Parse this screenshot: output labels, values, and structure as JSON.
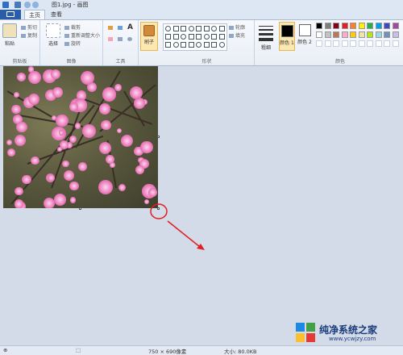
{
  "window": {
    "title": "图1.jpg - 画图"
  },
  "tabs": [
    {
      "label": "主页"
    },
    {
      "label": "查看"
    }
  ],
  "clipboard": {
    "paste_label": "粘贴",
    "cut_label": "剪切",
    "copy_label": "复制",
    "group_label": "剪贴板"
  },
  "image": {
    "select_label": "选择",
    "crop_label": "裁剪",
    "resize_label": "重新调整大小",
    "rotate_label": "旋转",
    "group_label": "图像"
  },
  "tools": {
    "group_label": "工具",
    "text_tool": "A"
  },
  "brushes": {
    "label": "刷子"
  },
  "shapes": {
    "group_label": "形状",
    "outline_label": "轮廓",
    "fill_label": "填充"
  },
  "size": {
    "label": "粗细"
  },
  "colors": {
    "color1_label": "颜色 1",
    "color2_label": "颜色 2",
    "group_label": "颜色",
    "color1": "#000000",
    "color2": "#ffffff",
    "palette_row1": [
      "#000000",
      "#7f7f7f",
      "#880015",
      "#ed1c24",
      "#ff7f27",
      "#fff200",
      "#22b14c",
      "#00a2e8",
      "#3f48cc",
      "#a349a4"
    ],
    "palette_row2": [
      "#ffffff",
      "#c3c3c3",
      "#b97a57",
      "#ffaec9",
      "#ffc90e",
      "#efe4b0",
      "#b5e61d",
      "#99d9ea",
      "#7092be",
      "#c8bfe7"
    ]
  },
  "status": {
    "dimensions": "750 × 690像素",
    "size": "大小: 80.0KB"
  },
  "annotation": {
    "circle_color": "#e02020",
    "arrow_color": "#e02020"
  },
  "watermark": {
    "line1": "纯净系统之家",
    "line2": "www.ycwjzy.com"
  }
}
